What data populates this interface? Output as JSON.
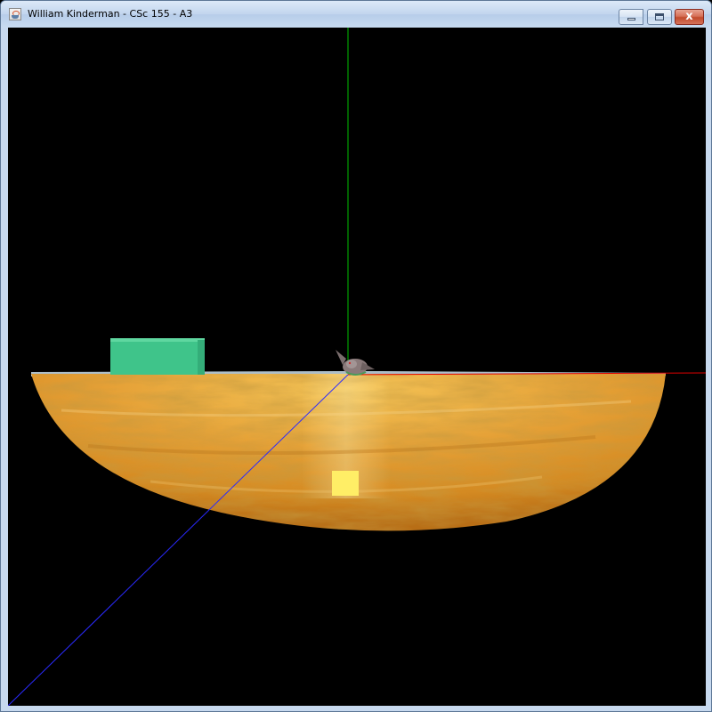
{
  "window": {
    "title": "William Kinderman - CSc 155 - A3",
    "icon": "java-cup-icon",
    "controls": {
      "minimize_icon": "minimize-icon",
      "maximize_icon": "maximize-icon",
      "close_icon": "close-icon",
      "close_glyph": "x"
    }
  },
  "scene": {
    "background_color": "#000000",
    "axes": {
      "x_axis_color": "#ff0000",
      "y_axis_color": "#00ff00",
      "z_axis_color": "#0000ff"
    },
    "objects": [
      {
        "name": "textured-terrain-bowl",
        "texture": "orange-marbled",
        "color": "#e8a23a"
      },
      {
        "name": "water-surface",
        "color": "#a9d6ee"
      },
      {
        "name": "green-box",
        "color": "#3fc48a"
      },
      {
        "name": "yellow-light-cube",
        "color": "#ffee66"
      },
      {
        "name": "creature-model",
        "color": "#8a7a7a"
      }
    ]
  }
}
